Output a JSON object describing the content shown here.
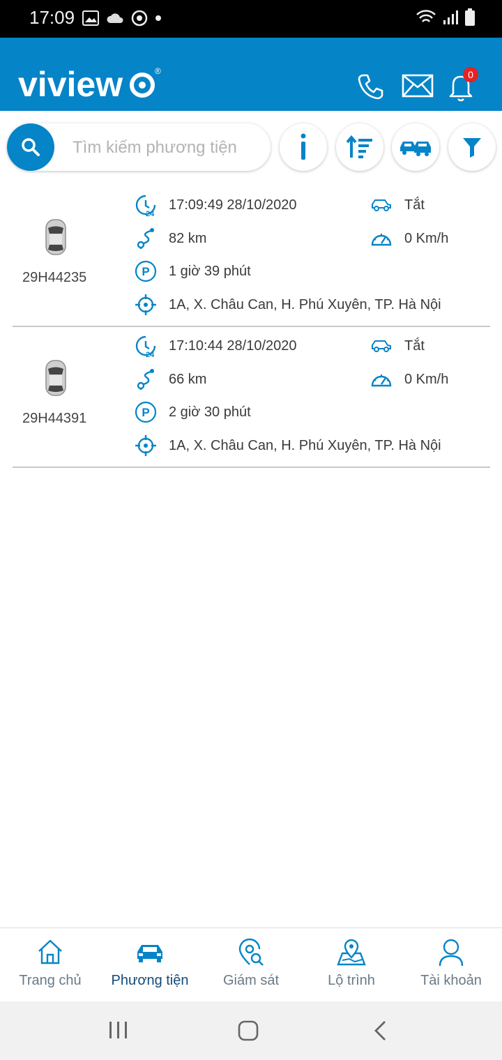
{
  "status_bar": {
    "time": "17:09"
  },
  "header": {
    "logo_text": "viview",
    "notification_count": "0",
    "colors": {
      "primary": "#0584c8",
      "badge": "#e62222"
    }
  },
  "search": {
    "placeholder": "Tìm kiếm phương tiện"
  },
  "vehicles": [
    {
      "plate": "29H44235",
      "timestamp": "17:09:49 28/10/2020",
      "engine": "Tắt",
      "distance": "82 km",
      "speed": "0 Km/h",
      "parked": "1 giờ 39 phút",
      "address": "1A, X. Châu Can, H. Phú Xuyên, TP. Hà Nội"
    },
    {
      "plate": "29H44391",
      "timestamp": "17:10:44 28/10/2020",
      "engine": "Tắt",
      "distance": "66 km",
      "speed": "0 Km/h",
      "parked": "2 giờ 30 phút",
      "address": "1A, X. Châu Can, H. Phú Xuyên, TP. Hà Nội"
    }
  ],
  "bottom_nav": [
    {
      "label": "Trang chủ",
      "icon": "home-icon"
    },
    {
      "label": "Phương tiện",
      "icon": "car-icon",
      "active": true
    },
    {
      "label": "Giám sát",
      "icon": "map-search-icon"
    },
    {
      "label": "Lộ trình",
      "icon": "route-map-icon"
    },
    {
      "label": "Tài khoản",
      "icon": "user-icon"
    }
  ]
}
